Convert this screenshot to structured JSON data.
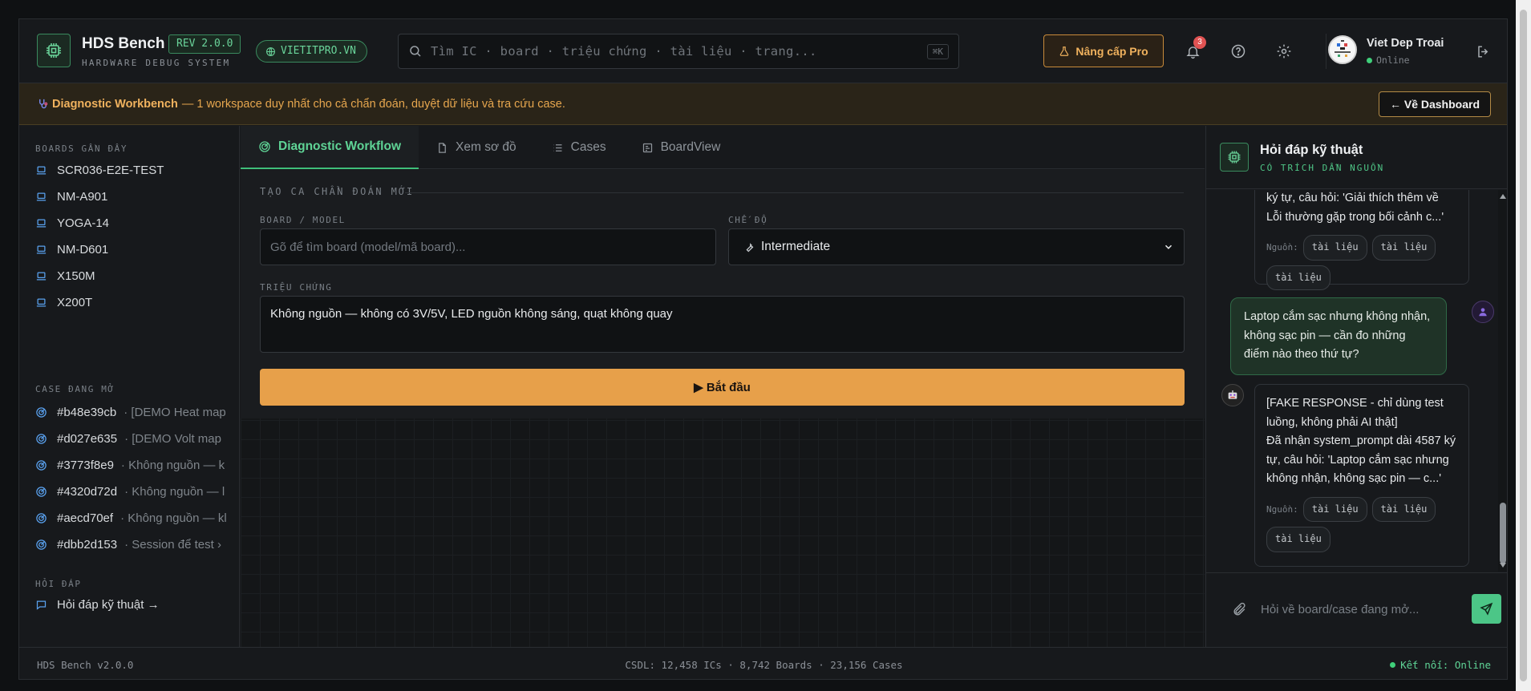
{
  "header": {
    "app_title": "HDS Bench",
    "app_subtitle": "HARDWARE DEBUG SYSTEM",
    "rev_badge": "REV 2.0.0",
    "domain": "VIETITPRO.VN",
    "search_placeholder": "Tìm IC · board · triệu chứng · tài liệu · trang...",
    "search_shortcut": "⌘K",
    "pro_button": "Nâng cấp Pro",
    "notification_count": "3",
    "user_name": "Viet Dep Troai",
    "user_status": "Online"
  },
  "banner": {
    "title": "Diagnostic Workbench",
    "text": "— 1 workspace duy nhất cho cả chẩn đoán, duyệt dữ liệu và tra cứu case.",
    "dashboard_button": "← Về Dashboard"
  },
  "sidebar": {
    "boards_label": "BOARDS GẦN ĐÂY",
    "boards": [
      "SCR036-E2E-TEST",
      "NM-A901",
      "YOGA-14",
      "NM-D601",
      "X150M",
      "X200T"
    ],
    "cases_label": "CASE ĐANG MỞ",
    "cases": [
      {
        "id": "#b48e39cb",
        "desc": "· [DEMO Heat map"
      },
      {
        "id": "#d027e635",
        "desc": "· [DEMO Volt map"
      },
      {
        "id": "#3773f8e9",
        "desc": "· Không nguồn — k"
      },
      {
        "id": "#4320d72d",
        "desc": "· Không nguồn — l"
      },
      {
        "id": "#aecd70ef",
        "desc": "· Không nguồn — kl"
      },
      {
        "id": "#dbb2d153",
        "desc": "· Session để test ›"
      }
    ],
    "qa_label": "HỎI ĐÁP",
    "qa_link": "Hỏi đáp kỹ thuật →"
  },
  "tabs": [
    "Diagnostic Workflow",
    "Xem sơ đồ",
    "Cases",
    "BoardView"
  ],
  "form": {
    "heading": "TẠO CA CHẨN ĐOÁN MỚI",
    "board_label": "BOARD / MODEL",
    "board_placeholder": "Gõ để tìm board (model/mã board)...",
    "mode_label": "CHẾ ĐỘ",
    "mode_value": "Intermediate",
    "symptom_label": "TRIỆU CHỨNG",
    "symptom_value": "Không nguồn — không có 3V/5V, LED nguồn không sáng, quạt không quay",
    "start_button": "▶ Bắt đầu"
  },
  "chat": {
    "title": "Hỏi đáp kỹ thuật",
    "subtitle": "CÓ TRÍCH DẪN NGUỒN",
    "bot_msg_1": "ký tự, câu hỏi: 'Giải thích thêm về Lỗi thường gặp trong bối cảnh c...'",
    "user_msg": "Laptop cắm sạc nhưng không nhận, không sạc pin — cần đo những điểm nào theo thứ tự?",
    "bot_msg_2": "[FAKE RESPONSE - chỉ dùng test luồng, không phải AI thật]\nĐã nhận system_prompt dài 4587 ký tự, câu hỏi: 'Laptop cắm sạc nhưng không nhận, không sạc pin — c...'",
    "sources_label": "Nguồn:",
    "source_chip": "tài liệu",
    "input_placeholder": "Hỏi về board/case đang mở..."
  },
  "footer": {
    "version": "HDS Bench v2.0.0",
    "stats": "CSDL: 12,458 ICs · 8,742 Boards · 23,156 Cases",
    "connection": "Kết nối: Online"
  },
  "colors": {
    "accent_green": "#4cc687",
    "accent_orange": "#e7a04a",
    "background": "#17191c"
  }
}
